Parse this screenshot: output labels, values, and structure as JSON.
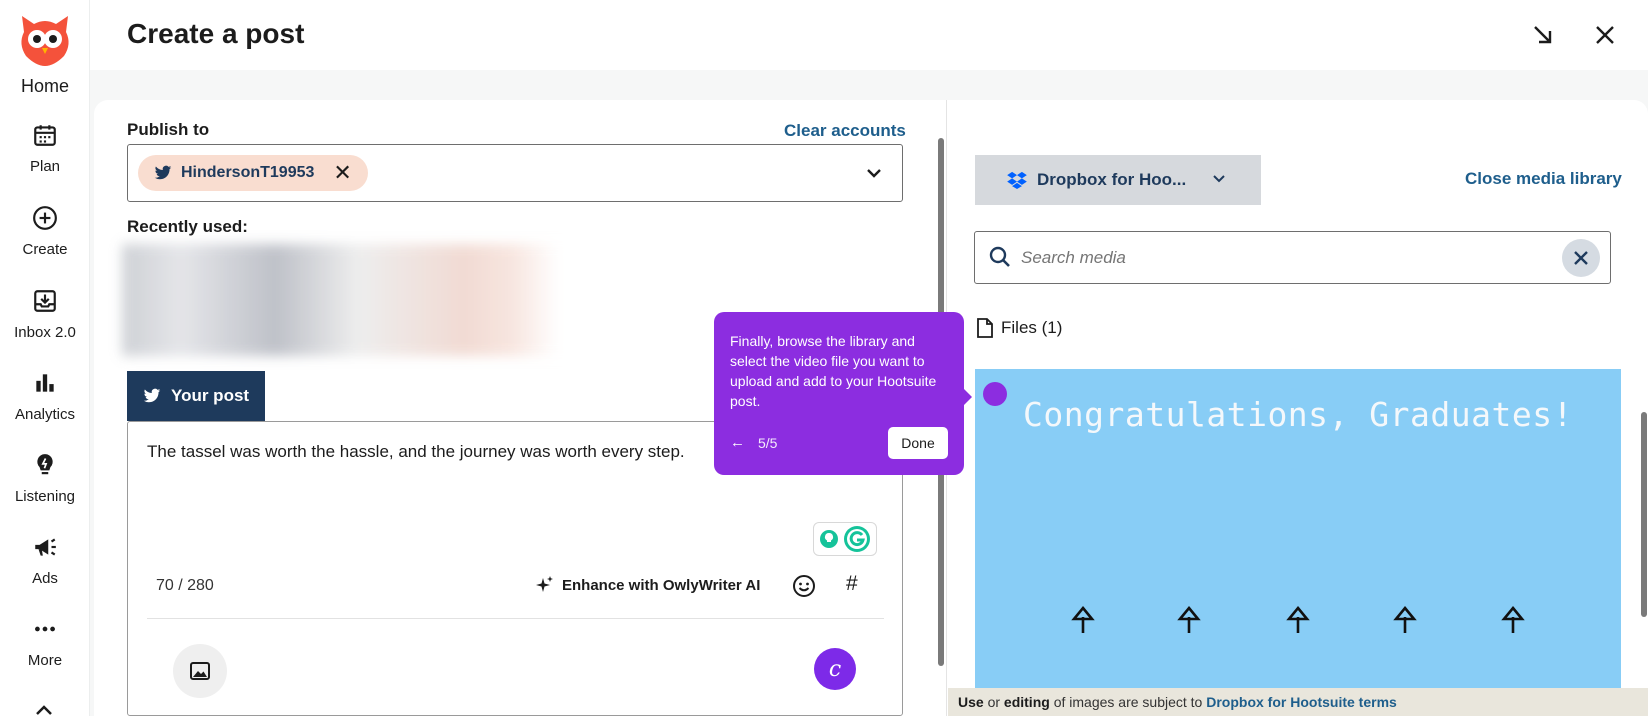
{
  "nav": {
    "home": "Home",
    "items": [
      {
        "label": "Plan",
        "icon": "calendar-icon"
      },
      {
        "label": "Create",
        "icon": "plus-circle-icon"
      },
      {
        "label": "Inbox 2.0",
        "icon": "inbox-icon"
      },
      {
        "label": "Analytics",
        "icon": "bar-chart-icon"
      },
      {
        "label": "Listening",
        "icon": "lightbulb-icon"
      },
      {
        "label": "Ads",
        "icon": "megaphone-icon"
      },
      {
        "label": "More",
        "icon": "more-dots-icon"
      }
    ]
  },
  "header": {
    "title": "Create a post"
  },
  "composer": {
    "publish_to_label": "Publish to",
    "clear_accounts": "Clear accounts",
    "account_chip": "HindersonT19953",
    "recently_used_label": "Recently used:",
    "your_post_tab": "Your post",
    "post_text": "The tassel was worth the hassle, and the journey was worth every step.",
    "char_counter": "70 / 280",
    "enhance_label": "Enhance with OwlyWriter AI"
  },
  "media_library": {
    "source": "Dropbox for Hoo...",
    "close_label": "Close media library",
    "search_placeholder": "Search media",
    "files_label": "Files (1)",
    "image_caption": "Congratulations, Graduates!",
    "footer": {
      "use": "Use",
      "or": " or ",
      "editing": "editing",
      "rest": " of images are subject to ",
      "link": "Dropbox for Hootsuite terms"
    }
  },
  "tooltip": {
    "text": "Finally, browse the library and select the video file you want to upload and add to your Hootsuite post.",
    "back": "←",
    "step": "5/5",
    "done": "Done"
  },
  "colors": {
    "brand_navy": "#1e3a5c",
    "link_blue": "#1e5e8c",
    "tooltip_purple": "#8c2de0",
    "chip_bg": "#f9ddd0",
    "media_bg": "#88cdf6"
  }
}
